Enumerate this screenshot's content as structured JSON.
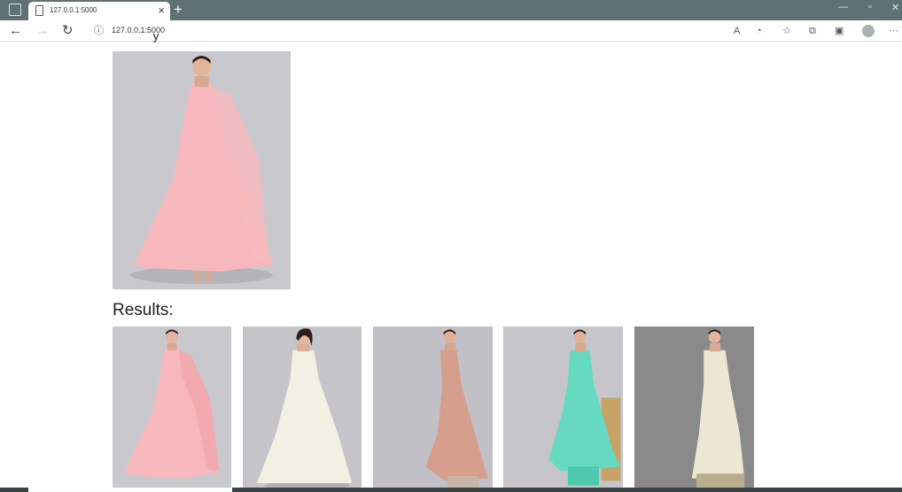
{
  "browser": {
    "tab_title": "127.0.0.1:5000",
    "url": "127.0.0.1:5000",
    "new_tab_symbol": "+",
    "close_symbol": "×"
  },
  "page": {
    "results_heading": "Results:"
  },
  "images": {
    "query": {
      "dress_color": "#f6b8bd",
      "background": "#c9c8cd"
    },
    "results": [
      {
        "dress_color": "#f6b8bd",
        "background": "#c9c8cd"
      },
      {
        "dress_color": "#f2efe3",
        "background": "#c4c4c9"
      },
      {
        "dress_color": "#d69e8c",
        "background": "#c1c0c6"
      },
      {
        "dress_color": "#66d9c3",
        "background": "#c6c5ca"
      },
      {
        "dress_color": "#ede6d2",
        "background": "#8a8a8a"
      }
    ]
  },
  "colors": {
    "tabstrip": "#5f7174",
    "page_background": "#ffffff"
  }
}
